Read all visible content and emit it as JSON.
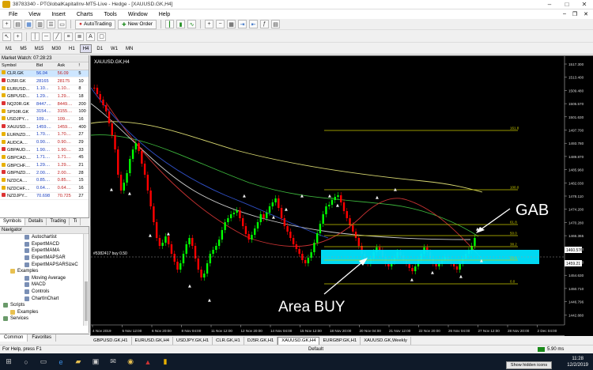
{
  "titlebar": {
    "title": "38783340 - PTGlobalKapitalInv-MT5-Live - Hedge - [XAUUSD.GK,H4]"
  },
  "menu": [
    "File",
    "View",
    "Insert",
    "Charts",
    "Tools",
    "Window",
    "Help"
  ],
  "toolbar": {
    "autotrading": "AutoTrading",
    "new_order": "New Order"
  },
  "timeframes": [
    "M1",
    "M5",
    "M15",
    "M30",
    "H1",
    "H4",
    "D1",
    "W1",
    "MN"
  ],
  "active_tf": "H4",
  "market_watch": {
    "title": "Market Watch: 07:28:23",
    "headers": [
      "Symbol",
      "Bid",
      "Ask",
      "!"
    ],
    "rows": [
      {
        "symbol": "CLR.GK",
        "bid": "56.04",
        "ask": "56.09",
        "spread": "5",
        "sel": true
      },
      {
        "symbol": "DJ5R.GK",
        "bid": "28165",
        "ask": "28175",
        "spread": "10"
      },
      {
        "symbol": "EURUSD...",
        "bid": "1.10...",
        "ask": "1.10...",
        "spread": "8"
      },
      {
        "symbol": "GBPUSD...",
        "bid": "1.29...",
        "ask": "1.29...",
        "spread": "18"
      },
      {
        "symbol": "NQ20R.GK",
        "bid": "8447....",
        "ask": "8449....",
        "spread": "200"
      },
      {
        "symbol": "SP50R.GK",
        "bid": "3154....",
        "ask": "3155....",
        "spread": "100"
      },
      {
        "symbol": "USDJPY....",
        "bid": "109....",
        "ask": "109....",
        "spread": "16"
      },
      {
        "symbol": "XAUUSD....",
        "bid": "1459....",
        "ask": "1459....",
        "spread": "400"
      },
      {
        "symbol": "EURNZD....",
        "bid": "1.70....",
        "ask": "1.70....",
        "spread": "27"
      },
      {
        "symbol": "AUDCA....",
        "bid": "0.90....",
        "ask": "0.90....",
        "spread": "29"
      },
      {
        "symbol": "GBPAUD....",
        "bid": "1.90....",
        "ask": "1.90....",
        "spread": "33"
      },
      {
        "symbol": "GBPCAD....",
        "bid": "1.71....",
        "ask": "1.71....",
        "spread": "45"
      },
      {
        "symbol": "GBPCHF....",
        "bid": "1.29....",
        "ask": "1.29....",
        "spread": "21"
      },
      {
        "symbol": "GBPNZD....",
        "bid": "2.00....",
        "ask": "2.00....",
        "spread": "28"
      },
      {
        "symbol": "NZDCA....",
        "bid": "0.85....",
        "ask": "0.85....",
        "spread": "15"
      },
      {
        "symbol": "NZDCHF....",
        "bid": "0.64....",
        "ask": "0.64....",
        "spread": "16"
      },
      {
        "symbol": "NZDJPY...",
        "bid": "70.698",
        "ask": "70.725",
        "spread": "27"
      }
    ],
    "tabs": [
      "Symbols",
      "Details",
      "Trading",
      "Ti"
    ]
  },
  "navigator": {
    "title": "Navigator",
    "items": [
      {
        "label": "Autochartist",
        "indent": 3,
        "kind": "i"
      },
      {
        "label": "ExpertMACD",
        "indent": 3,
        "kind": "i"
      },
      {
        "label": "ExpertMAMA",
        "indent": 3,
        "kind": "i"
      },
      {
        "label": "ExpertMAPSAR",
        "indent": 3,
        "kind": "i"
      },
      {
        "label": "ExpertMAPSARSizeC",
        "indent": 3,
        "kind": "i"
      },
      {
        "label": "Examples",
        "indent": 1,
        "kind": "f"
      },
      {
        "label": "Moving Average",
        "indent": 3,
        "kind": "i"
      },
      {
        "label": "MACD",
        "indent": 3,
        "kind": "i"
      },
      {
        "label": "Controls",
        "indent": 3,
        "kind": "i"
      },
      {
        "label": "ChartInChart",
        "indent": 3,
        "kind": "i"
      },
      {
        "label": "Scripts",
        "indent": 0,
        "kind": "s"
      },
      {
        "label": "Examples",
        "indent": 1,
        "kind": "f"
      },
      {
        "label": "Services",
        "indent": 0,
        "kind": "s"
      }
    ],
    "tabs": [
      "Common",
      "Favorites"
    ]
  },
  "chart": {
    "label": "XAUUSD.GK,H4",
    "price_ticks": [
      "1517.300",
      "1513.400",
      "1509.480",
      "1505.570",
      "1501.630",
      "1497.700",
      "1493.780",
      "1489.870",
      "1485.960",
      "1482.030",
      "1478.110",
      "1474.200",
      "1470.280",
      "1466.365",
      "1462.450",
      "1458.550",
      "1454.630",
      "1450.710",
      "1446.796",
      "1442.880"
    ],
    "date_ticks": [
      "4 Nov 2019",
      "5 Nov 12:00",
      "6 Nov 20:00",
      "8 Nov 04:00",
      "11 Nov 12:00",
      "12 Nov 20:00",
      "14 Nov 04:00",
      "15 Nov 12:00",
      "18 Nov 20:00",
      "20 Nov 04:00",
      "21 Nov 12:00",
      "22 Nov 20:00",
      "26 Nov 04:00",
      "27 Nov 12:00",
      "28 Nov 20:00",
      "2 Dec 04:00"
    ],
    "fib_labels": [
      "161.8",
      "100.0",
      "61.8",
      "50.0",
      "38.2",
      "23.6",
      "0.0"
    ],
    "current_price": "1460.576",
    "price_box": "1459.21",
    "left_tag": "#5382417 buy 0.50",
    "annotations": {
      "gab": "GAB",
      "area": "Area BUY"
    }
  },
  "chart_tabs": [
    "GBPUSD.GK,H1",
    "EURUSD.GK,H4",
    "USDJPY.GK,H1",
    "CLR.GK,H1",
    "DJ5R.GK,H1",
    "XAUUSD.GK,H4",
    "EURGBP.GK,H1",
    "XAUUSD.GK,Weekly"
  ],
  "active_chart_tab": "XAUUSD.GK,H4",
  "status": {
    "help": "For Help, press F1",
    "profile": "Default",
    "network": "5.90 ms"
  },
  "clock": {
    "time": "11:28",
    "date": "12/2/2019",
    "tooltip": "Show hidden icons"
  },
  "colors": {
    "bull": "#00ff00",
    "bear": "#ff0000",
    "area": "#00e5ff",
    "fib": "#c8c800"
  }
}
